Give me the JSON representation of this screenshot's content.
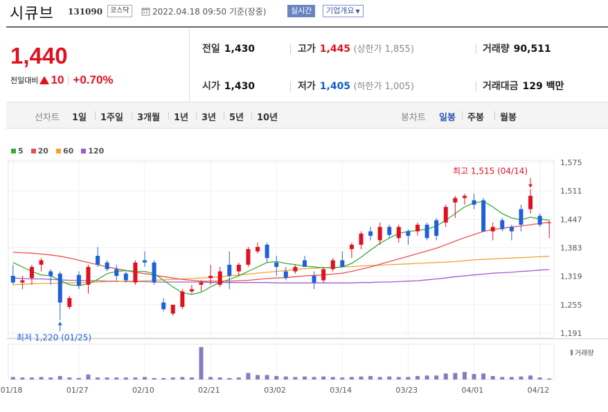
{
  "header": {
    "stock_name": "시큐브",
    "stock_code": "131090",
    "market": "코스닥",
    "date": "2022.04.18 09:50 기준(장중)",
    "realtime_label": "실시간",
    "company_label": "기업개요"
  },
  "price": {
    "current": "1,440",
    "change_label": "전일대비",
    "change_amount": "10",
    "change_pct": "+0.70%"
  },
  "stats": {
    "prev_label": "전일",
    "prev": "1,430",
    "high_label": "고가",
    "high": "1,445",
    "upper_limit": "(상한가 1,855)",
    "volume_label": "거래량",
    "volume": "90,511",
    "open_label": "시가",
    "open": "1,430",
    "low_label": "저가",
    "low": "1,405",
    "lower_limit": "(하한가 1,005)",
    "amount_label": "거래대금",
    "amount": "129 백만"
  },
  "periods": {
    "line_label": "선차트",
    "line_items": [
      "1일",
      "1주일",
      "3개월",
      "1년",
      "3년",
      "5년",
      "10년"
    ],
    "candle_label": "봉차트",
    "candle_items": [
      "일봉",
      "주봉",
      "월봉"
    ],
    "active_candle": "일봉"
  },
  "colors": {
    "up": "#e01020",
    "down": "#1e60d8",
    "ma5": "#3aaa35",
    "ma20": "#e85050",
    "ma60": "#f5a030",
    "ma120": "#9a5ccf",
    "volume": "#8a78c0"
  },
  "chart_data": {
    "type": "candlestick",
    "legend": [
      {
        "name": "5",
        "color": "#3aaa35"
      },
      {
        "name": "20",
        "color": "#e85050"
      },
      {
        "name": "60",
        "color": "#f5a030"
      },
      {
        "name": "120",
        "color": "#9a5ccf"
      }
    ],
    "y_ticks": [
      "1,575",
      "1,511",
      "1,447",
      "1,383",
      "1,319",
      "1,255",
      "1,191"
    ],
    "ylim": [
      1191,
      1575
    ],
    "x_ticks": [
      {
        "label": "01/18",
        "index": 0
      },
      {
        "label": "01/27",
        "index": 7
      },
      {
        "label": "02/10",
        "index": 14
      },
      {
        "label": "02/21",
        "index": 21
      },
      {
        "label": "03/02",
        "index": 28
      },
      {
        "label": "03/14",
        "index": 35
      },
      {
        "label": "03/23",
        "index": 42
      },
      {
        "label": "04/01",
        "index": 49
      },
      {
        "label": "04/12",
        "index": 56
      }
    ],
    "annotations": {
      "high": "최고 1,515 (04/14)",
      "low": "최저 1,220 (01/25)"
    },
    "volume_label": "거래량",
    "candles": [
      {
        "o": 1320,
        "h": 1345,
        "l": 1300,
        "c": 1305
      },
      {
        "o": 1305,
        "h": 1320,
        "l": 1290,
        "c": 1310
      },
      {
        "o": 1315,
        "h": 1345,
        "l": 1300,
        "c": 1340
      },
      {
        "o": 1345,
        "h": 1360,
        "l": 1330,
        "c": 1355
      },
      {
        "o": 1330,
        "h": 1335,
        "l": 1300,
        "c": 1320
      },
      {
        "o": 1325,
        "h": 1330,
        "l": 1220,
        "c": 1260
      },
      {
        "o": 1250,
        "h": 1275,
        "l": 1245,
        "c": 1270
      },
      {
        "o": 1322,
        "h": 1330,
        "l": 1290,
        "c": 1298
      },
      {
        "o": 1300,
        "h": 1345,
        "l": 1280,
        "c": 1340
      },
      {
        "o": 1365,
        "h": 1385,
        "l": 1340,
        "c": 1345
      },
      {
        "o": 1350,
        "h": 1355,
        "l": 1330,
        "c": 1335
      },
      {
        "o": 1335,
        "h": 1345,
        "l": 1310,
        "c": 1320
      },
      {
        "o": 1325,
        "h": 1330,
        "l": 1305,
        "c": 1310
      },
      {
        "o": 1305,
        "h": 1355,
        "l": 1300,
        "c": 1350
      },
      {
        "o": 1355,
        "h": 1375,
        "l": 1340,
        "c": 1350
      },
      {
        "o": 1350,
        "h": 1355,
        "l": 1300,
        "c": 1305
      },
      {
        "o": 1260,
        "h": 1270,
        "l": 1240,
        "c": 1245
      },
      {
        "o": 1235,
        "h": 1250,
        "l": 1230,
        "c": 1255
      },
      {
        "o": 1250,
        "h": 1290,
        "l": 1245,
        "c": 1285
      },
      {
        "o": 1285,
        "h": 1300,
        "l": 1280,
        "c": 1290
      },
      {
        "o": 1300,
        "h": 1310,
        "l": 1285,
        "c": 1305
      },
      {
        "o": 1315,
        "h": 1345,
        "l": 1300,
        "c": 1320
      },
      {
        "o": 1300,
        "h": 1340,
        "l": 1295,
        "c": 1330
      },
      {
        "o": 1345,
        "h": 1375,
        "l": 1290,
        "c": 1320
      },
      {
        "o": 1330,
        "h": 1350,
        "l": 1320,
        "c": 1345
      },
      {
        "o": 1345,
        "h": 1385,
        "l": 1340,
        "c": 1380
      },
      {
        "o": 1375,
        "h": 1395,
        "l": 1370,
        "c": 1385
      },
      {
        "o": 1390,
        "h": 1395,
        "l": 1350,
        "c": 1360
      },
      {
        "o": 1350,
        "h": 1365,
        "l": 1320,
        "c": 1340
      },
      {
        "o": 1330,
        "h": 1340,
        "l": 1310,
        "c": 1315
      },
      {
        "o": 1330,
        "h": 1345,
        "l": 1325,
        "c": 1340
      },
      {
        "o": 1355,
        "h": 1365,
        "l": 1340,
        "c": 1340
      },
      {
        "o": 1320,
        "h": 1330,
        "l": 1290,
        "c": 1305
      },
      {
        "o": 1310,
        "h": 1340,
        "l": 1305,
        "c": 1335
      },
      {
        "o": 1335,
        "h": 1360,
        "l": 1330,
        "c": 1355
      },
      {
        "o": 1355,
        "h": 1375,
        "l": 1350,
        "c": 1340
      },
      {
        "o": 1380,
        "h": 1395,
        "l": 1360,
        "c": 1390
      },
      {
        "o": 1390,
        "h": 1420,
        "l": 1380,
        "c": 1415
      },
      {
        "o": 1420,
        "h": 1430,
        "l": 1400,
        "c": 1410
      },
      {
        "o": 1400,
        "h": 1440,
        "l": 1390,
        "c": 1430
      },
      {
        "o": 1430,
        "h": 1435,
        "l": 1405,
        "c": 1412
      },
      {
        "o": 1405,
        "h": 1435,
        "l": 1395,
        "c": 1430
      },
      {
        "o": 1420,
        "h": 1425,
        "l": 1390,
        "c": 1410
      },
      {
        "o": 1420,
        "h": 1440,
        "l": 1410,
        "c": 1435
      },
      {
        "o": 1435,
        "h": 1440,
        "l": 1400,
        "c": 1405
      },
      {
        "o": 1445,
        "h": 1450,
        "l": 1400,
        "c": 1410
      },
      {
        "o": 1440,
        "h": 1480,
        "l": 1430,
        "c": 1475
      },
      {
        "o": 1485,
        "h": 1500,
        "l": 1450,
        "c": 1495
      },
      {
        "o": 1495,
        "h": 1505,
        "l": 1480,
        "c": 1500
      },
      {
        "o": 1490,
        "h": 1505,
        "l": 1470,
        "c": 1480
      },
      {
        "o": 1490,
        "h": 1495,
        "l": 1420,
        "c": 1420
      },
      {
        "o": 1420,
        "h": 1440,
        "l": 1400,
        "c": 1430
      },
      {
        "o": 1445,
        "h": 1450,
        "l": 1420,
        "c": 1425
      },
      {
        "o": 1430,
        "h": 1435,
        "l": 1400,
        "c": 1420
      },
      {
        "o": 1470,
        "h": 1480,
        "l": 1420,
        "c": 1435
      },
      {
        "o": 1470,
        "h": 1515,
        "l": 1460,
        "c": 1500
      },
      {
        "o": 1455,
        "h": 1460,
        "l": 1430,
        "c": 1435
      },
      {
        "o": 1440,
        "h": 1445,
        "l": 1405,
        "c": 1440
      }
    ],
    "volumes": [
      5,
      4,
      4,
      5,
      4,
      7,
      4,
      3,
      10,
      4,
      4,
      4,
      4,
      4,
      5,
      3,
      3,
      4,
      5,
      4,
      65,
      5,
      4,
      3,
      4,
      13,
      9,
      9,
      7,
      6,
      5,
      6,
      5,
      6,
      5,
      4,
      5,
      6,
      7,
      5,
      6,
      5,
      5,
      7,
      8,
      8,
      12,
      13,
      15,
      11,
      12,
      7,
      5,
      5,
      6,
      8,
      4,
      2
    ],
    "ma5": [
      1350,
      1340,
      1330,
      1322,
      1320,
      1310,
      1300,
      1298,
      1302,
      1312,
      1325,
      1330,
      1332,
      1330,
      1330,
      1325,
      1310,
      1295,
      1282,
      1278,
      1283,
      1295,
      1305,
      1312,
      1320,
      1330,
      1340,
      1350,
      1352,
      1348,
      1345,
      1342,
      1340,
      1338,
      1338,
      1340,
      1348,
      1362,
      1378,
      1393,
      1405,
      1415,
      1420,
      1422,
      1425,
      1432,
      1445,
      1460,
      1475,
      1484,
      1488,
      1475,
      1460,
      1450,
      1446,
      1452,
      1448,
      1445
    ],
    "ma20": [
      1373,
      1372,
      1371,
      1369,
      1367,
      1364,
      1360,
      1355,
      1350,
      1345,
      1340,
      1336,
      1332,
      1328,
      1325,
      1322,
      1318,
      1315,
      1312,
      1310,
      1308,
      1308,
      1308,
      1308,
      1309,
      1310,
      1312,
      1314,
      1315,
      1316,
      1318,
      1320,
      1321,
      1322,
      1324,
      1326,
      1330,
      1335,
      1340,
      1346,
      1352,
      1358,
      1364,
      1370,
      1376,
      1382,
      1390,
      1398,
      1406,
      1413,
      1420,
      1424,
      1427,
      1430,
      1432,
      1435,
      1438,
      1440
    ],
    "ma60": [
      1300,
      1301,
      1302,
      1303,
      1303,
      1304,
      1304,
      1305,
      1305,
      1306,
      1307,
      1307,
      1308,
      1308,
      1309,
      1310,
      1311,
      1312,
      1313,
      1314,
      1315,
      1316,
      1318,
      1320,
      1322,
      1324,
      1326,
      1328,
      1330,
      1332,
      1334,
      1336,
      1337,
      1338,
      1339,
      1340,
      1341,
      1342,
      1343,
      1344,
      1345,
      1346,
      1347,
      1348,
      1349,
      1350,
      1351,
      1352,
      1354,
      1356,
      1357,
      1358,
      1359,
      1360,
      1361,
      1362,
      1363,
      1364
    ],
    "ma120": [
      1315,
      1314,
      1313,
      1313,
      1312,
      1311,
      1310,
      1310,
      1309,
      1309,
      1308,
      1308,
      1307,
      1307,
      1307,
      1306,
      1306,
      1306,
      1306,
      1306,
      1306,
      1305,
      1305,
      1305,
      1305,
      1305,
      1305,
      1305,
      1304,
      1304,
      1304,
      1304,
      1304,
      1304,
      1304,
      1304,
      1304,
      1305,
      1305,
      1306,
      1306,
      1307,
      1308,
      1309,
      1311,
      1313,
      1315,
      1318,
      1320,
      1322,
      1324,
      1326,
      1327,
      1328,
      1330,
      1331,
      1333,
      1334
    ]
  }
}
